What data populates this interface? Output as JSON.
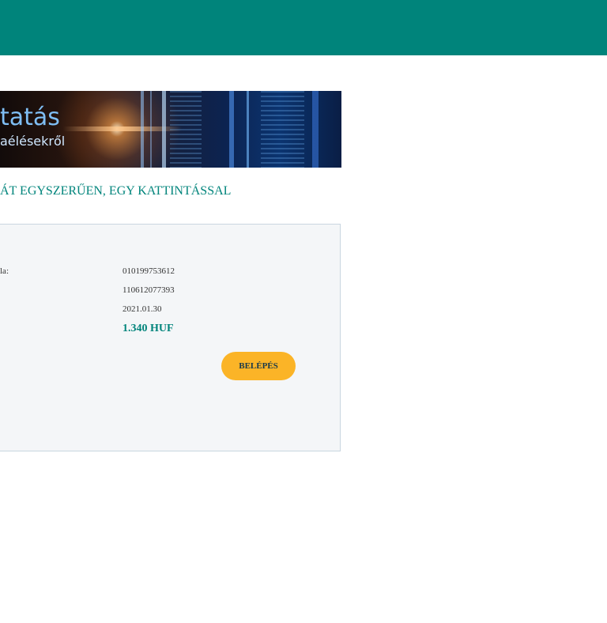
{
  "banner": {
    "title": "tatás",
    "subtitle": "aélésekről"
  },
  "tagline": "ÁT EGYSZERŰEN, EGY KATTINTÁSSAL",
  "details": {
    "label_fragment": "la:",
    "rows": [
      {
        "value": "010199753612"
      },
      {
        "value": "110612077393"
      },
      {
        "value": "2021.01.30"
      }
    ],
    "amount": "1.340 HUF"
  },
  "login_button": {
    "label": "BELÉPÉS",
    "color": "#fbb427"
  },
  "colors": {
    "brand": "#00847b",
    "card_bg": "#f4f6f8",
    "card_border": "#c9d6e0"
  }
}
